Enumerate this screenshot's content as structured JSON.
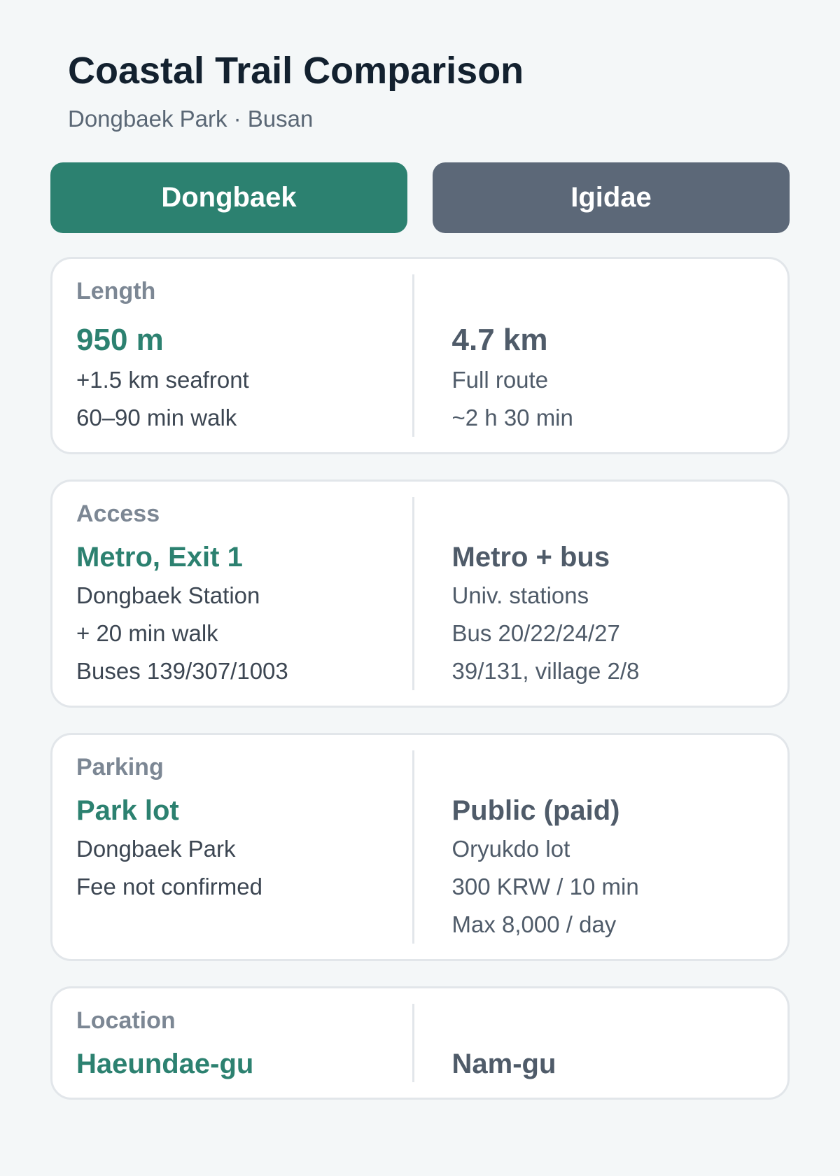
{
  "header": {
    "title": "Coastal Trail Comparison",
    "subtitle": "Dongbaek Park · Busan"
  },
  "tabs": [
    {
      "label": "Dongbaek",
      "color": "#2c8170"
    },
    {
      "label": "Igidae",
      "color": "#5c6878"
    }
  ],
  "cards": {
    "length": {
      "label": "Length",
      "left": {
        "value": "950 m",
        "lines": [
          "+1.5 km seafront",
          "60–90 min walk"
        ]
      },
      "right": {
        "value": "4.7 km",
        "lines": [
          "Full route",
          "~2 h 30 min"
        ]
      }
    },
    "access": {
      "label": "Access",
      "left": {
        "value": "Metro, Exit 1",
        "lines": [
          "Dongbaek Station",
          "+ 20 min walk",
          "Buses 139/307/1003"
        ]
      },
      "right": {
        "value": "Metro + bus",
        "lines": [
          "Univ. stations",
          "Bus 20/22/24/27",
          "39/131, village 2/8"
        ]
      }
    },
    "parking": {
      "label": "Parking",
      "left": {
        "value": "Park lot",
        "lines": [
          "Dongbaek Park",
          "Fee not confirmed"
        ]
      },
      "right": {
        "value": "Public (paid)",
        "lines": [
          "Oryukdo lot",
          "300 KRW / 10 min",
          "Max 8,000 / day"
        ]
      }
    },
    "location": {
      "label": "Location",
      "left": {
        "value": "Haeundae-gu"
      },
      "right": {
        "value": "Nam-gu"
      }
    }
  }
}
